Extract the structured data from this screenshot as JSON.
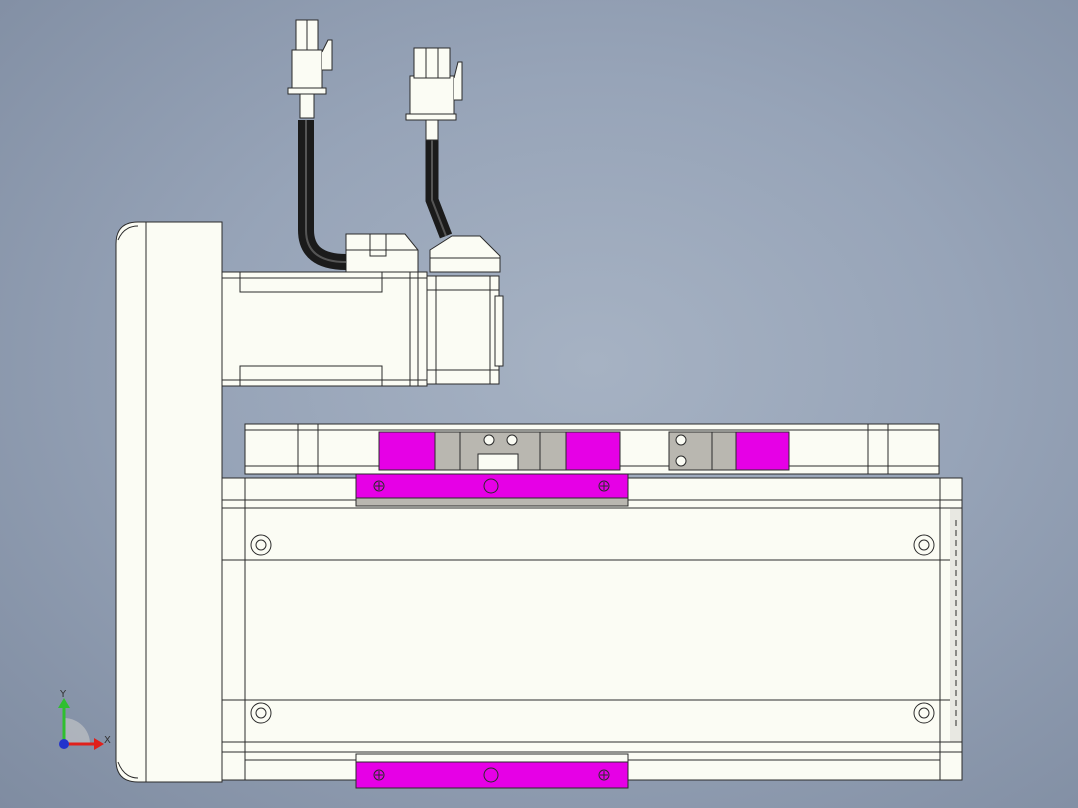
{
  "viewport": {
    "background_top": "#9aa7ba",
    "background_bottom": "#7f8ca1"
  },
  "model": {
    "colors": {
      "body_fill": "#fbfcf4",
      "edge_stroke": "#2b2b2b",
      "highlight_magenta": "#e600e6",
      "gray_fill": "#b9b7b0",
      "cable_black": "#1b1b1b"
    }
  },
  "triad": {
    "x_label": "X",
    "y_label": "Y",
    "x_color": "#e0201b",
    "y_color": "#2fbf2f",
    "z_color": "#2233cc"
  }
}
